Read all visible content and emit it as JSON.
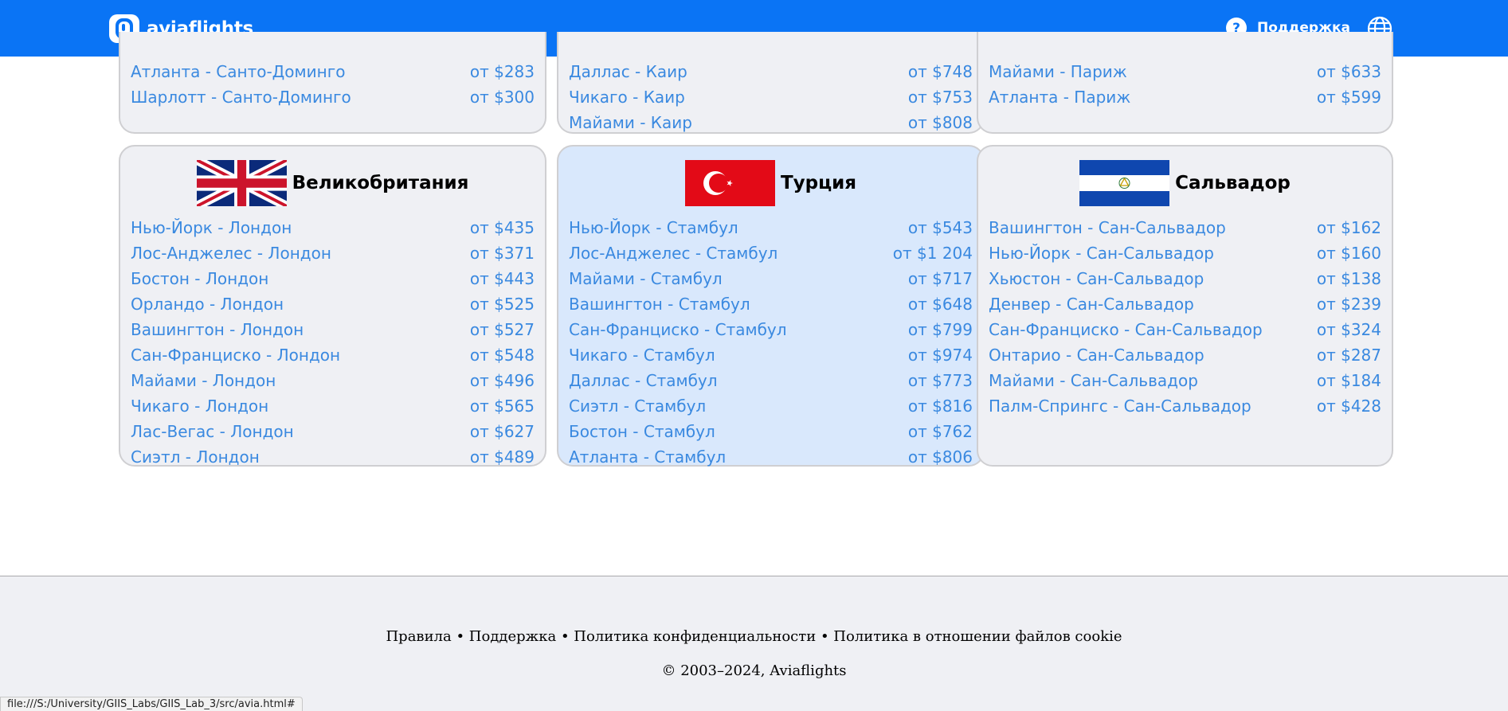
{
  "header": {
    "brand": "aviaflights",
    "support_label": "Поддержка"
  },
  "colors": {
    "header_bg": "#0a74f5",
    "link": "#3a89e0",
    "card_bg": "#eff0f4",
    "card_active_bg": "#d9e8fc"
  },
  "top_cards": [
    {
      "routes": [
        {
          "route": "Атланта - Санто-Доминго",
          "price": "от $283"
        },
        {
          "route": "Шарлотт - Санто-Доминго",
          "price": "от $300"
        }
      ]
    },
    {
      "routes": [
        {
          "route": "Даллас - Каир",
          "price": "от $748"
        },
        {
          "route": "Чикаго - Каир",
          "price": "от $753"
        },
        {
          "route": "Майами - Каир",
          "price": "от $808"
        }
      ]
    },
    {
      "routes": [
        {
          "route": "Майами - Париж",
          "price": "от $633"
        },
        {
          "route": "Атланта - Париж",
          "price": "от $599"
        }
      ]
    }
  ],
  "bottom_cards": [
    {
      "country": "Великобритания",
      "flag_icon": "uk-flag-icon",
      "routes": [
        {
          "route": "Нью-Йорк - Лондон",
          "price": "от $435"
        },
        {
          "route": "Лос-Анджелес - Лондон",
          "price": "от $371"
        },
        {
          "route": "Бостон - Лондон",
          "price": "от $443"
        },
        {
          "route": "Орландо - Лондон",
          "price": "от $525"
        },
        {
          "route": "Вашингтон - Лондон",
          "price": "от $527"
        },
        {
          "route": "Сан-Франциско - Лондон",
          "price": "от $548"
        },
        {
          "route": "Майами - Лондон",
          "price": "от $496"
        },
        {
          "route": "Чикаго - Лондон",
          "price": "от $565"
        },
        {
          "route": "Лас-Вегас - Лондон",
          "price": "от $627"
        },
        {
          "route": "Сиэтл - Лондон",
          "price": "от $489"
        }
      ]
    },
    {
      "country": "Турция",
      "flag_icon": "turkey-flag-icon",
      "routes": [
        {
          "route": "Нью-Йорк - Стамбул",
          "price": "от $543"
        },
        {
          "route": "Лос-Анджелес - Стамбул",
          "price": "от $1 204"
        },
        {
          "route": "Майами - Стамбул",
          "price": "от $717"
        },
        {
          "route": "Вашингтон - Стамбул",
          "price": "от $648"
        },
        {
          "route": "Сан-Франциско - Стамбул",
          "price": "от $799"
        },
        {
          "route": "Чикаго - Стамбул",
          "price": "от $974"
        },
        {
          "route": "Даллас - Стамбул",
          "price": "от $773"
        },
        {
          "route": "Сиэтл - Стамбул",
          "price": "от $816"
        },
        {
          "route": "Бостон - Стамбул",
          "price": "от $762"
        },
        {
          "route": "Атланта - Стамбул",
          "price": "от $806"
        }
      ]
    },
    {
      "country": "Сальвадор",
      "flag_icon": "el-salvador-flag-icon",
      "routes": [
        {
          "route": "Вашингтон - Сан-Сальвадор",
          "price": "от $162"
        },
        {
          "route": "Нью-Йорк - Сан-Сальвадор",
          "price": "от $160"
        },
        {
          "route": "Хьюстон - Сан-Сальвадор",
          "price": "от $138"
        },
        {
          "route": "Денвер - Сан-Сальвадор",
          "price": "от $239"
        },
        {
          "route": "Сан-Франциско - Сан-Сальвадор",
          "price": "от $324"
        },
        {
          "route": "Онтарио - Сан-Сальвадор",
          "price": "от $287"
        },
        {
          "route": "Майами - Сан-Сальвадор",
          "price": "от $184"
        },
        {
          "route": "Палм-Спрингс - Сан-Сальвадор",
          "price": "от $428"
        }
      ]
    }
  ],
  "footer": {
    "links": [
      "Правила",
      "Поддержка",
      "Политика конфиденциальности",
      "Политика в отношении файлов cookie"
    ],
    "separator": " • ",
    "copyright": "© 2003–2024, Aviaflights"
  },
  "status_bar": "file:///S:/University/GIIS_Labs/GIIS_Lab_3/src/avia.html#"
}
